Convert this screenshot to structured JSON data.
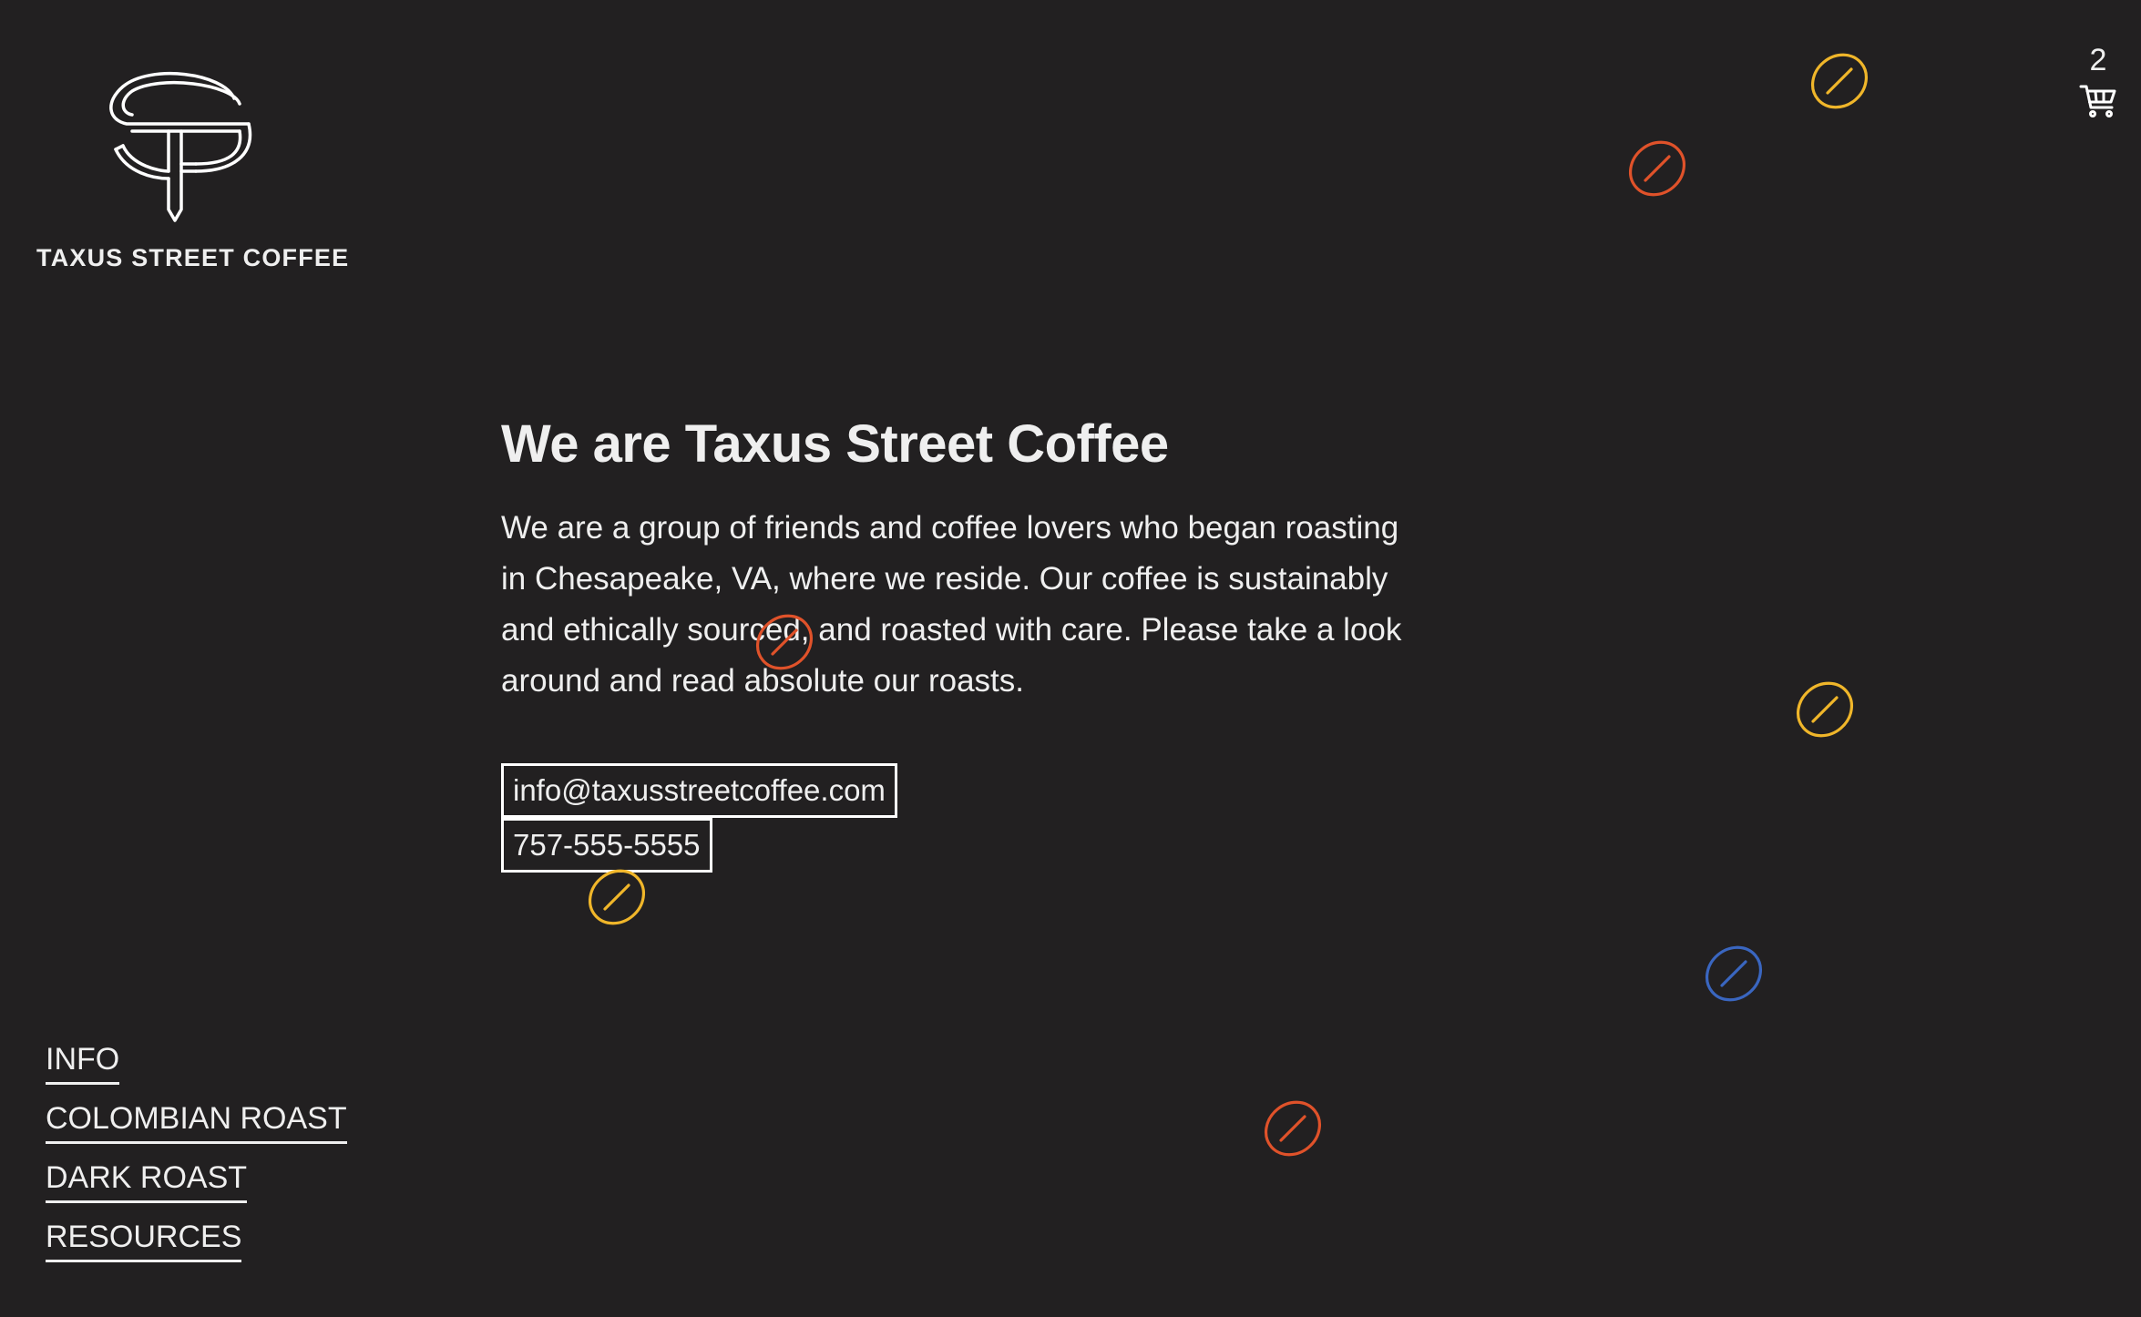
{
  "brand": {
    "name": "TAXUS STREET COFFEE",
    "logo_icon": "ts-monogram-icon"
  },
  "cart": {
    "count": "2",
    "icon": "cart-icon"
  },
  "main": {
    "heading": "We are Taxus Street Coffee",
    "paragraph": "We are a group of friends and coffee lovers who began roasting in Chesapeake, VA, where we reside. Our coffee is sustainably and ethically sourced, and roasted with care. Please take a look around and read absolute our roasts.",
    "email": "info@taxusstreetcoffee.com",
    "phone": "757-555-5555"
  },
  "nav": {
    "items": [
      {
        "label": "INFO"
      },
      {
        "label": "COLOMBIAN ROAST"
      },
      {
        "label": "DARK ROAST"
      },
      {
        "label": "RESOURCES"
      }
    ]
  },
  "colors": {
    "background": "#222021",
    "text": "#efefef",
    "bean_yellow": "#f0b62a",
    "bean_orange": "#e0522a",
    "bean_blue": "#3a66c0"
  }
}
